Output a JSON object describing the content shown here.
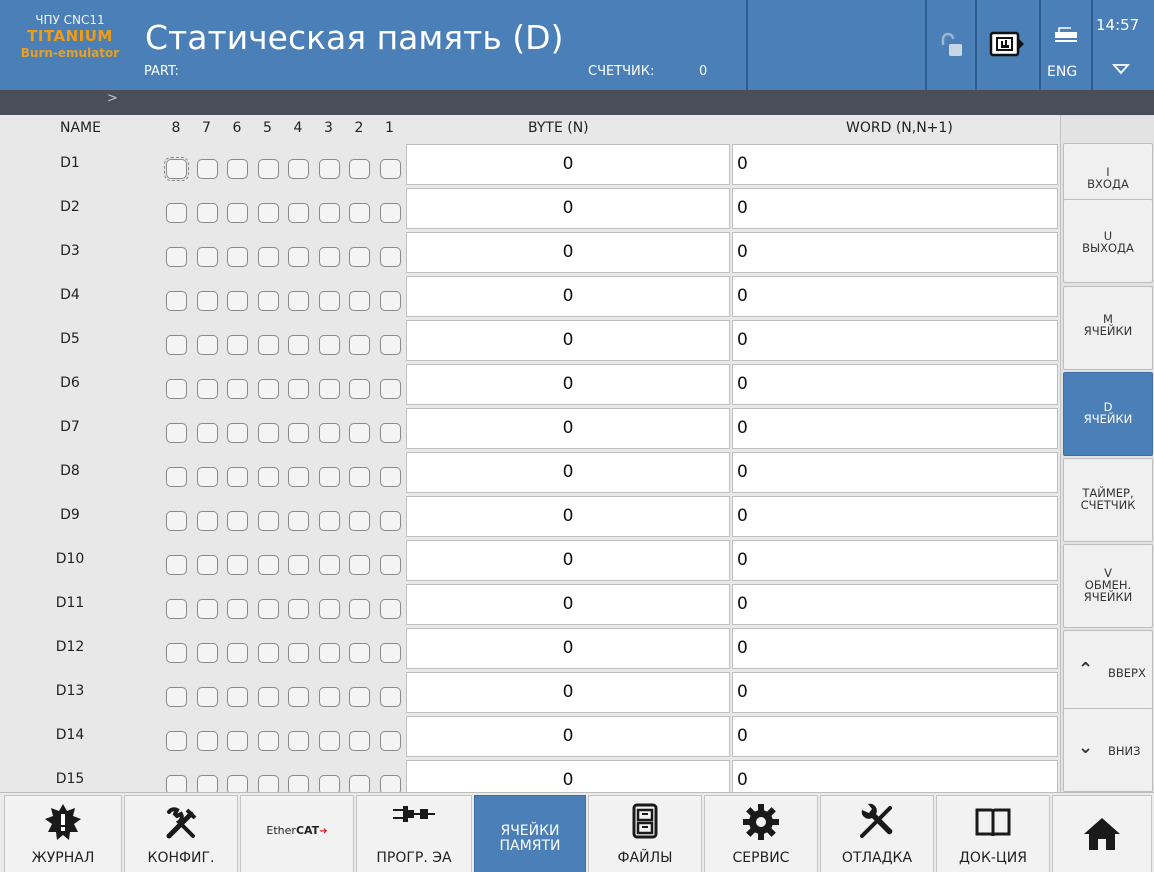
{
  "header": {
    "brand_line1": "ЧПУ CNC11",
    "brand_line2": "TITANIUM",
    "brand_line3": "Burn-emulator",
    "title": "Статическая память (D)",
    "part_label": "PART:",
    "counter_label": "СЧЕТЧИК:",
    "counter_value": "0",
    "language": "ENG",
    "time": "14:57"
  },
  "breadcrumb": ">",
  "table": {
    "col_name": "NAME",
    "bit_labels": [
      "8",
      "7",
      "6",
      "5",
      "4",
      "3",
      "2",
      "1"
    ],
    "col_byte": "BYTE (N)",
    "col_word": "WORD (N,N+1)",
    "rows": [
      {
        "name": "D1",
        "byte": "0",
        "word": "0"
      },
      {
        "name": "D2",
        "byte": "0",
        "word": "0"
      },
      {
        "name": "D3",
        "byte": "0",
        "word": "0"
      },
      {
        "name": "D4",
        "byte": "0",
        "word": "0"
      },
      {
        "name": "D5",
        "byte": "0",
        "word": "0"
      },
      {
        "name": "D6",
        "byte": "0",
        "word": "0"
      },
      {
        "name": "D7",
        "byte": "0",
        "word": "0"
      },
      {
        "name": "D8",
        "byte": "0",
        "word": "0"
      },
      {
        "name": "D9",
        "byte": "0",
        "word": "0"
      },
      {
        "name": "D10",
        "byte": "0",
        "word": "0"
      },
      {
        "name": "D11",
        "byte": "0",
        "word": "0"
      },
      {
        "name": "D12",
        "byte": "0",
        "word": "0"
      },
      {
        "name": "D13",
        "byte": "0",
        "word": "0"
      },
      {
        "name": "D14",
        "byte": "0",
        "word": "0"
      },
      {
        "name": "D15",
        "byte": "0",
        "word": "0"
      }
    ]
  },
  "side": {
    "inputs": {
      "l1": "I",
      "l2": "ВХОДА"
    },
    "outputs": {
      "l1": "U",
      "l2": "ВЫХОДА"
    },
    "m_cells": {
      "l1": "M",
      "l2": "ЯЧЕЙКИ"
    },
    "d_cells": {
      "l1": "D",
      "l2": "ЯЧЕЙКИ"
    },
    "timers": {
      "l1": "ТАЙМЕР,",
      "l2": "СЧЕТЧИК"
    },
    "exchange": {
      "l1": "V",
      "l2": "ОБМЕН.",
      "l3": "ЯЧЕЙКИ"
    },
    "up": "ВВЕРХ",
    "down": "ВНИЗ"
  },
  "toolbar": {
    "journal": "ЖУРНАЛ",
    "config": "КОНФИГ.",
    "ethercat_a": "Ether",
    "ethercat_b": "CAT",
    "prog": "ПРОГР. ЭА",
    "memory_l1": "ЯЧЕЙКИ",
    "memory_l2": "ПАМЯТИ",
    "files": "ФАЙЛЫ",
    "service": "СЕРВИС",
    "debug": "ОТЛАДКА",
    "docs": "ДОК-ЦИЯ"
  },
  "colors": {
    "accent": "#4a7fb8",
    "brand_orange": "#f39c12",
    "subbar": "#4a4e58",
    "ethercat_red": "#e02020"
  },
  "icons": {
    "lock": "unlocked-padlock-icon",
    "mode": "hand-mode-icon",
    "language": "keyboard-icon",
    "clock_menu": "chevron-down-icon",
    "journal": "warning-burst-icon",
    "config": "tools-icon",
    "prog": "connector-icon",
    "files": "cabinet-icon",
    "service": "gear-icon",
    "debug": "wrench-screwdriver-icon",
    "docs": "book-icon",
    "home": "home-icon"
  }
}
